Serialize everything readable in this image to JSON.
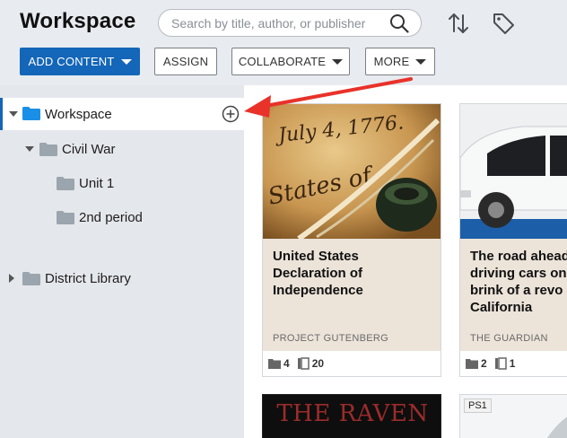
{
  "header": {
    "title": "Workspace",
    "search_placeholder": "Search by title, author, or publisher"
  },
  "toolbar": {
    "add_content": "ADD CONTENT",
    "assign": "ASSIGN",
    "collaborate": "COLLABORATE",
    "more": "MORE"
  },
  "sidebar": {
    "items": [
      {
        "label": "Workspace",
        "expanded": true,
        "selected": true
      },
      {
        "label": "Civil War",
        "expanded": true
      },
      {
        "label": "Unit 1"
      },
      {
        "label": "2nd period"
      },
      {
        "label": "District Library",
        "expanded": false
      }
    ]
  },
  "cards": [
    {
      "title": "United States\nDeclaration of\nIndependence",
      "publisher": "PROJECT GUTENBERG",
      "folders": "4",
      "items": "20"
    },
    {
      "title": "The road ahead\ndriving cars on\nbrink of a revo\nCalifornia",
      "publisher": "THE GUARDIAN",
      "folders": "2",
      "items": "1"
    },
    {
      "thumb_text": "THE RAVEN"
    },
    {
      "badge": "PS1"
    }
  ],
  "colors": {
    "accent": "#1466b8",
    "folder_blue": "#1a8fe6",
    "folder_gray": "#9aa5ae",
    "annotation_red": "#e8322a"
  }
}
